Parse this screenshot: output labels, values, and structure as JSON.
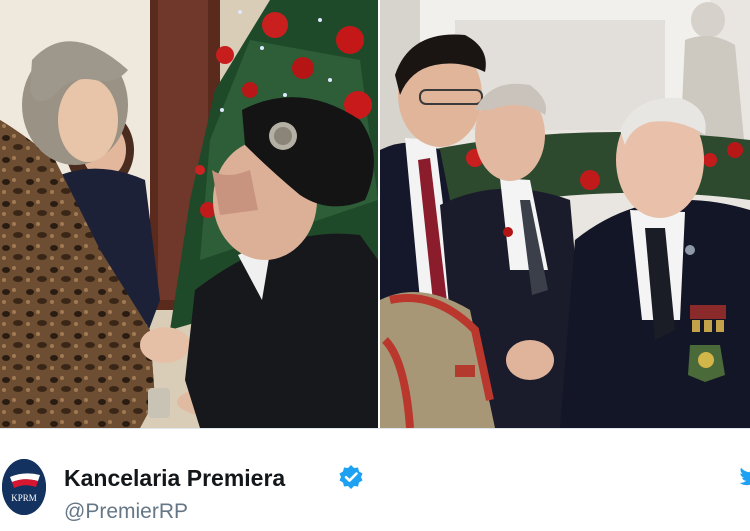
{
  "tweet": {
    "display_name": "Kancelaria Premiera",
    "handle": "@PremierRP",
    "avatar_text": "KPRM",
    "verified": true,
    "verified_icon": "verified-badge-icon",
    "platform_icon": "twitter-bird-icon"
  },
  "colors": {
    "verified_blue": "#1da1f2",
    "avatar_navy": "#13325f",
    "name_text": "#14171a",
    "handle_text": "#657786"
  }
}
